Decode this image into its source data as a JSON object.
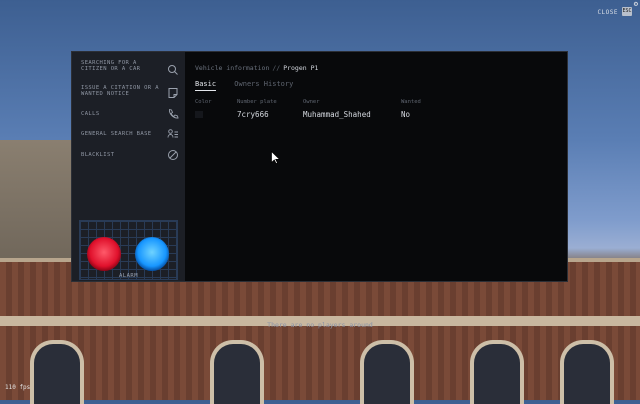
{
  "hud": {
    "close_label": "CLOSE",
    "close_key": "ESC",
    "fps": "110 fps",
    "no_players": "There are no players around"
  },
  "sidebar": {
    "items": [
      {
        "label": "SEARCHING FOR A CITIZEN OR A CAR",
        "icon": "search-icon"
      },
      {
        "label": "ISSUE A CITATION OR A WANTED NOTICE",
        "icon": "note-icon"
      },
      {
        "label": "CALLS",
        "icon": "phone-icon"
      },
      {
        "label": "GENERAL SEARCH BASE",
        "icon": "user-list-icon"
      },
      {
        "label": "BLACKLIST",
        "icon": "block-icon"
      }
    ],
    "alarm_label": "ALARM"
  },
  "content": {
    "breadcrumb": {
      "parent": "Vehicle information",
      "separator": "//",
      "current": "Progen P1"
    },
    "tabs": [
      "Basic",
      "Owners History"
    ],
    "active_tab": "Basic",
    "columns": [
      {
        "header": "Color",
        "value": ""
      },
      {
        "header": "Number plate",
        "value": "7cry666"
      },
      {
        "header": "Owner",
        "value": "Muhammad_Shahed"
      },
      {
        "header": "Wanted",
        "value": "No"
      }
    ]
  },
  "colors": {
    "siren_red": "#e0112c",
    "siren_blue": "#1796ff",
    "vehicle_color": "#15171c"
  }
}
